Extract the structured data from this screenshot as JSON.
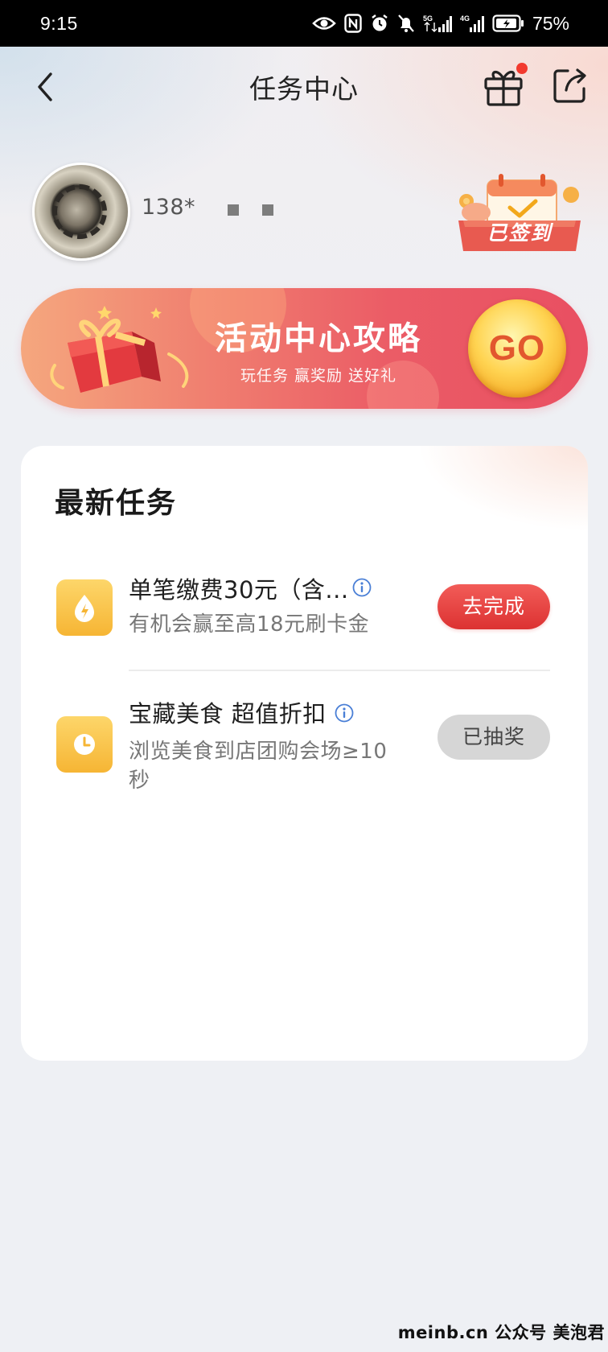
{
  "status_bar": {
    "time": "9:15",
    "battery": "75%",
    "icons": [
      "eye-icon",
      "nfc-icon",
      "alarm-icon",
      "mute-icon",
      "5g-signal-icon",
      "4g-signal-icon",
      "battery-icon"
    ]
  },
  "header": {
    "title": "任务中心",
    "has_notification_dot": true
  },
  "profile": {
    "phone_masked": "138*",
    "checkin_label": "已签到"
  },
  "banner": {
    "title": "活动中心攻略",
    "subtitle": "玩任务 赢奖励 送好礼",
    "go_label": "GO"
  },
  "tasks_section": {
    "title": "最新任务",
    "items": [
      {
        "name": "单笔缴费30元（含...",
        "description": "有机会赢至高18元刷卡金",
        "button_label": "去完成",
        "button_state": "active",
        "icon": "payment-drop-icon"
      },
      {
        "name": "宝藏美食 超值折扣",
        "description": "浏览美食到店团购会场≥10",
        "description_line2": "秒",
        "button_label": "已抽奖",
        "button_state": "done",
        "icon": "clock-icon"
      }
    ]
  },
  "watermark": "meinb.cn  公众号 美泡君",
  "colors": {
    "accent_red": "#dc3232",
    "banner_gradient": [
      "#f5a77e",
      "#e94f62"
    ],
    "icon_yellow": "#f6b534"
  }
}
